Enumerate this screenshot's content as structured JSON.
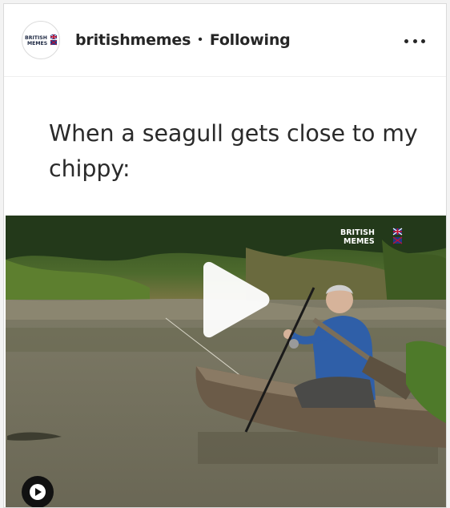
{
  "post": {
    "username": "britishmemes",
    "separator": "•",
    "follow_status": "Following",
    "more_icon": "more-horizontal-icon",
    "avatar_logo": {
      "line1": "BRITISH",
      "line2": "MEMES"
    },
    "caption": "When a seagull gets close to my chippy:",
    "video": {
      "watermark": {
        "line1": "BRITISH",
        "line2": "MEMES"
      },
      "play_icon": "play-icon",
      "reel_icon": "play-circle-icon"
    }
  },
  "colors": {
    "text": "#262626",
    "border": "#dbdbdb",
    "river": "#7a7665",
    "foliage": "#4f6e2e",
    "shirt": "#2f5fa8"
  }
}
